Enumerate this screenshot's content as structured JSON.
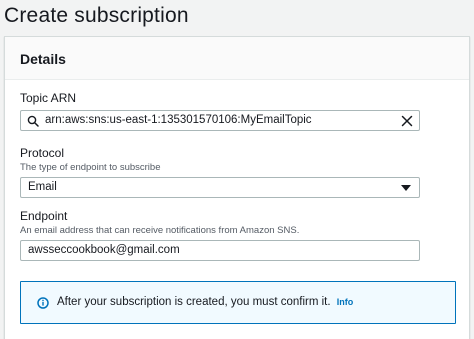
{
  "page": {
    "title": "Create subscription"
  },
  "details": {
    "heading": "Details",
    "topic_arn": {
      "label": "Topic ARN",
      "value": "arn:aws:sns:us-east-1:135301570106:MyEmailTopic"
    },
    "protocol": {
      "label": "Protocol",
      "description": "The type of endpoint to subscribe",
      "value": "Email"
    },
    "endpoint": {
      "label": "Endpoint",
      "description": "An email address that can receive notifications from Amazon SNS.",
      "value": "awsseccookbook@gmail.com"
    },
    "alert": {
      "message": "After your subscription is created, you must confirm it.",
      "link_label": "Info"
    }
  },
  "colors": {
    "background": "#f2f3f3",
    "link": "#0073bb",
    "alert_background": "#f1faff",
    "alert_border": "#0073bb"
  },
  "icons": [
    "search-icon",
    "clear-icon",
    "caret-down-icon",
    "info-icon"
  ]
}
